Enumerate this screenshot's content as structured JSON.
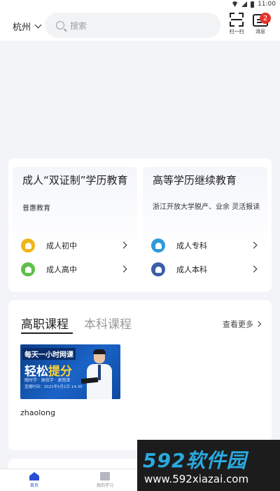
{
  "status_bar": {
    "time": "11:00"
  },
  "header": {
    "city": "杭州",
    "search_placeholder": "搜索",
    "scan_label": "扫一扫",
    "message_label": "消息",
    "message_badge": "2"
  },
  "edu": {
    "left": {
      "title": "成人“双证制”学历教育",
      "subtitle": "普惠教育",
      "items": [
        {
          "label": "成人初中",
          "icon_color": "#f1b419"
        },
        {
          "label": "成人高中",
          "icon_color": "#5fbf4a"
        }
      ]
    },
    "right": {
      "title": "高等学历继续教育",
      "subtitle": "浙江开放大学脱产、业余 灵活报读",
      "items": [
        {
          "label": "成人专科",
          "icon_color": "#2e9bd8"
        },
        {
          "label": "成人本科",
          "icon_color": "#3b5ea8"
        }
      ]
    }
  },
  "courses": {
    "tab_active": "高职课程",
    "tab_inactive": "本科课程",
    "more_label": "查看更多",
    "banner": {
      "tag": "每天一小时网课",
      "headline_a": "轻松",
      "headline_b": "提分",
      "line1": "随时学 · 高效学 · 更简单",
      "line2": "直播时间：2021年5月1日 14:30"
    },
    "course_name": "zhaolong"
  },
  "bottom_nav": {
    "home": "首页",
    "study": "我的学习"
  },
  "watermark": {
    "brand": "592软件园",
    "url": "www.592xiazai.com"
  },
  "colors": {
    "accent": "#2a4fd6",
    "badge": "#e5332a",
    "banner_bg": "#1a63c7",
    "watermark_blue": "#2aa9e0"
  }
}
